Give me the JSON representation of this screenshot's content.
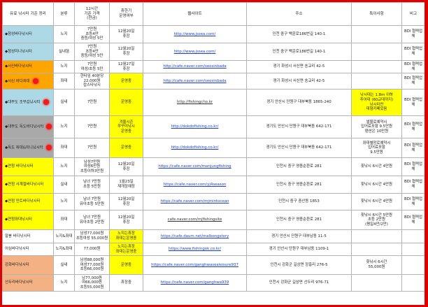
{
  "headers": {
    "name": "유료 낚시터 기준 정리",
    "type": "분류",
    "price": "12시간\n기준 가격\n(현금)",
    "hours": "휴한기\n운영여부",
    "site": "웹사이트",
    "addr": "주소",
    "special": "특이사항",
    "note": "비고"
  },
  "rows": [
    {
      "name": "◆청성바다낚시터",
      "type": "노지",
      "price": "7만원\n초등4만\n중등/여성 5만",
      "hours": "12월20일\n휴장",
      "site": "http://www.jssea.com/",
      "addr": "인천 중구 백운로186번길 140-1",
      "special": "",
      "note": "BDI 협력업체",
      "color": "c-blue",
      "mark": false,
      "hl_hours": false,
      "hl_special": false,
      "link": "blue"
    },
    {
      "name": "◆청성미니낚시터",
      "type": "실내형",
      "price": "7만원\n초등4만\n중등/여성 5만",
      "hours": "12월20일\n휴장",
      "site": "http://www.jssea.com/",
      "addr": "인천 중구 백운로186번길 140-1",
      "special": "",
      "note": "BDI 협력업체",
      "color": "c-blue",
      "mark": false,
      "hl_hours": false,
      "hl_special": false,
      "link": "blue"
    },
    {
      "name": "◆서신바다낚시터",
      "type": "노지",
      "price": "7만원\n여성/초등 5만",
      "hours": "12월27일\n휴장",
      "site": "http://cafe.naver.com/seosinbada",
      "addr": "경기 화성시 서신면 송교리 42-5",
      "special": "",
      "note": "BDI 협력업체",
      "color": "c-orange",
      "mark": false,
      "hl_hours": false,
      "hl_special": false,
      "link": "blue"
    },
    {
      "name": "◆서신 바다좌대",
      "type": "좌대",
      "price": "한타임 40분당\n22,000원\n랍스타낚시",
      "hours": "운영중",
      "site": "http://cafe.naver.com/seosinbada",
      "addr": "경기 화성시 서신면 송교리 42-5",
      "special": "",
      "note": "BDI 협력업체",
      "color": "c-orange",
      "mark": true,
      "hl_hours": true,
      "hl_special": false,
      "link": "blue"
    },
    {
      "name": "◆대부도 조부감낚시터",
      "type": "실내",
      "price": "7만원",
      "hours": "운영중",
      "site": "http://fishingcho.kr",
      "addr": "경기 안산시 단원구 대부북동 1865-240",
      "special": "낚시대는 1.8m 이하\n추어대 (60교대까지)\n낚시터만\n대형카페있음",
      "note": "BDI 협력업체",
      "color": "c-blue",
      "mark": true,
      "hl_hours": true,
      "hl_special": true,
      "link": "gray"
    },
    {
      "name": "◆대부도 독도바다낚시터",
      "type": "노지",
      "price": "7만원",
      "hours": "겨울시즌\n쭈꾸미낚시\n운영중",
      "site": "http://dokdofishing.co.kr/",
      "addr": "경기도 안산시 단원구 대부북동 642-171",
      "special": "썰물로예약시\n입어료포함 9.5만원\n팬션은 10만원",
      "note": "BDI 협력업체",
      "color": "c-gray",
      "mark": true,
      "hl_hours": true,
      "hl_special": false,
      "link": "blue"
    },
    {
      "name": "◆독도 좌대&미니낚시터",
      "type": "좌대",
      "price": "7만원",
      "hours": "운영중",
      "site": "http://dokdofishing.co.kr/",
      "addr": "경기도 안산시 단원구 대부북동 642-171",
      "special": "좌대별망로예약시\n입어료포함\n9.5만원",
      "note": "BDI 협력업체",
      "color": "c-gray",
      "mark": true,
      "hl_hours": true,
      "hl_special": false,
      "link": "blue"
    },
    {
      "name": "◆연청 바다낚시터",
      "type": "노지",
      "price": "남성7만원\n여성6만원\n초등이하3만원",
      "hours": "12월20일\n휴장",
      "site": "https://cafe.naver.com/manjungfishing",
      "addr": "인천시 중구 영종순환로 281",
      "special": "횟낚시 6시간 4만원",
      "note": "BDI 협력업체",
      "color": "c-yellow",
      "mark": false,
      "hl_hours": false,
      "hl_special": false,
      "link": "blue"
    },
    {
      "name": "◆연청 사계절바다낚시터",
      "type": "실내",
      "price": "남녀 7만원\n초등 5만원",
      "hours": "1월23일\n재개장예정",
      "site": "https://cafe.naver.com/yj4season",
      "addr": "인천시 중구 영종순환로 281",
      "special": "횟낚시 6시간 4만원",
      "note": "BDI 협력업체",
      "color": "c-yellow",
      "mark": false,
      "hl_hours": false,
      "hl_special": false,
      "link": "blue"
    },
    {
      "name": "◆연청 민트바다낚시터",
      "type": "노지",
      "price": "남녀 7만원\n유아초등 5만원",
      "hours": "12월20일\n휴장",
      "site": "https://cafe.naver.com/mjmintocean",
      "addr": "인천시 중구 중산동 1853",
      "special": "횟낚시 6시간 4만원",
      "note": "BDI 협력업체",
      "color": "c-yellow",
      "mark": false,
      "hl_hours": false,
      "hl_special": false,
      "link": "blue"
    },
    {
      "name": "◆연청좌대낚시터",
      "type": "좌대",
      "price": "남녀 7만원\n유아초등 2만원",
      "hours": "12월20일\n휴장",
      "site": "cafe.naver.com/mjfishingsite",
      "addr": "인천시 중구 영종순환로 281",
      "special": "횟낚시 6시간 5만원\n초등 2만원\n(평일4만/2만)",
      "note": "BDI 협력업체",
      "color": "c-yellow",
      "mark": false,
      "hl_hours": false,
      "hl_special": false,
      "link": "gray"
    },
    {
      "name": "말봉 바다낚시터",
      "type": "노지&좌대",
      "price": "남성77,000원\n초등여성 55,000원",
      "hours": "노지는휴장\n좌대는운영중",
      "site": "https://cafe.daum.net/malbongstory",
      "addr": "경기 안산시 단원구 대부남동 11-5",
      "special": "",
      "note": "",
      "color": "c-white",
      "mark": false,
      "hl_hours": true,
      "hl_special": false,
      "link": "blue"
    },
    {
      "name": "어심바다낚시터",
      "type": "노지&좌대",
      "price": "77,000원",
      "hours": "노지는휴장\n좌대는운영중",
      "site": "https://www.fishingok.co.kr/",
      "addr": "경기 안산시 단원구 대부남동 1109-1",
      "special": "",
      "note": "",
      "color": "c-white",
      "mark": false,
      "hl_hours": true,
      "hl_special": false,
      "link": "blue"
    },
    {
      "name": "강화바다낚시터",
      "type": "실내",
      "price": "남성88,000원\n여성77,000원\n초등66,000원",
      "hours": "운영중",
      "site": "https://cafe.naver.com/ganghwasealeisure937",
      "addr": "인천시 강화군 길상면 장흥리 276-5",
      "special": "횟낚시 6시간\n55,000원",
      "note": "",
      "color": "c-peach",
      "mark": false,
      "hl_hours": true,
      "hl_special": false,
      "link": "blue"
    },
    {
      "name": "선두리바다낚시터",
      "type": "노지",
      "price": "남77,000원\n여66,000원\n초등55,000원",
      "hours": "휴장중",
      "site": "https://cafe.naver.com/ganghwa939",
      "addr": "인천시 강화군 길상면 선두리 976-71",
      "special": "",
      "note": "",
      "color": "c-peach",
      "mark": false,
      "hl_hours": false,
      "hl_special": false,
      "link": "blue"
    }
  ]
}
